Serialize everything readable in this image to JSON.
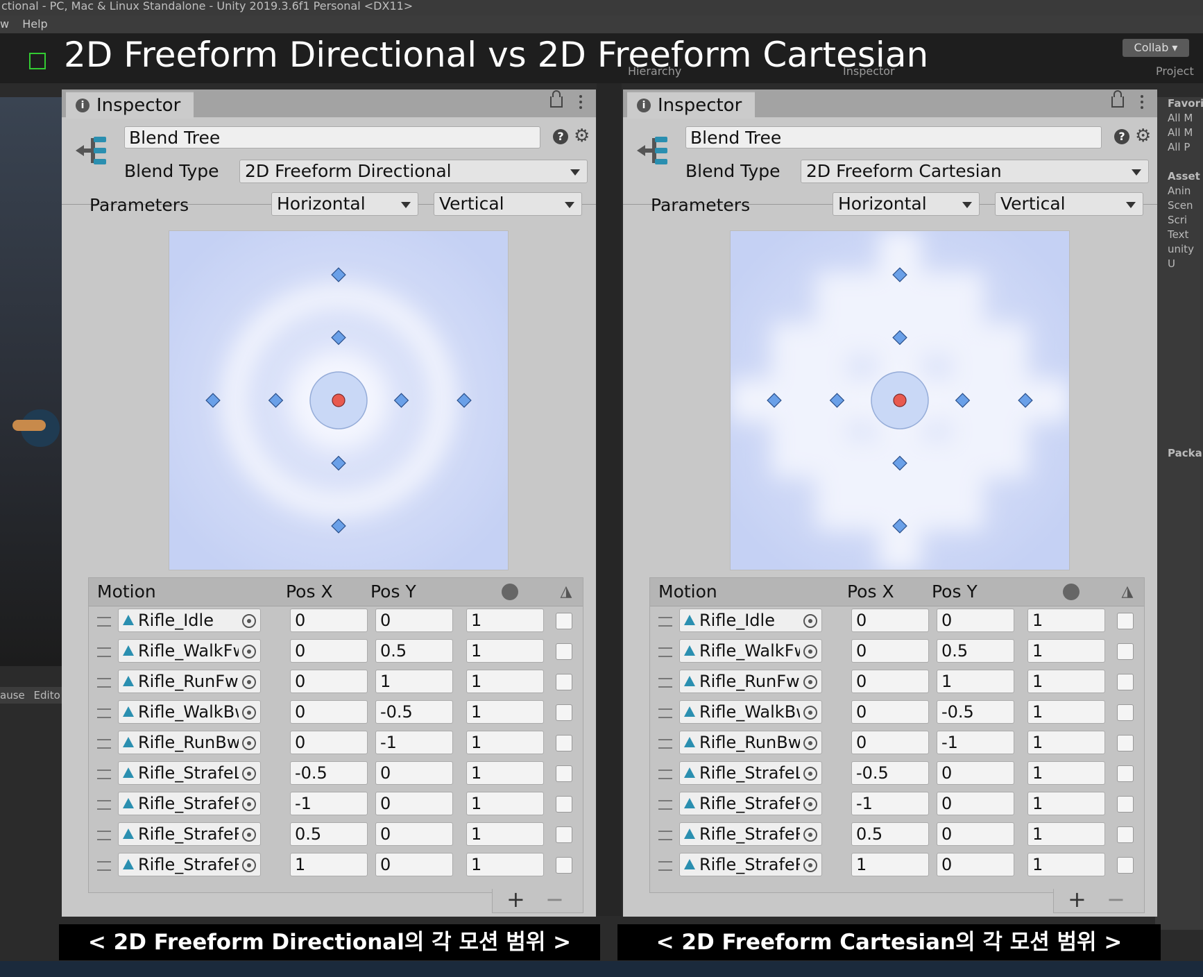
{
  "window": {
    "title_fragment": "ctional - PC, Mac & Linux Standalone - Unity 2019.3.6f1 Personal <DX11>",
    "menu": [
      "w",
      "Help"
    ],
    "collab": "Collab ▾",
    "hierarchy_tab": "Hierarchy",
    "inspector_tab": "Inspector",
    "project_tab": "Project",
    "gamebar": [
      "ause",
      "Edito"
    ],
    "project_items": [
      "Favori",
      "All M",
      "All M",
      "All P",
      "",
      "Asset",
      "Anin",
      "Scen",
      "Scri",
      "Text",
      "unity",
      "U",
      "",
      "",
      "",
      "",
      "",
      "",
      "",
      "",
      "",
      "",
      "",
      "",
      "Packa"
    ]
  },
  "video_title": "2D Freeform Directional vs 2D Freeform Cartesian",
  "panels": [
    {
      "tab_label": "Inspector",
      "name_value": "Blend Tree",
      "blend_type_label": "Blend Type",
      "blend_type_value": "2D Freeform Directional",
      "parameters_label": "Parameters",
      "param_x": "Horizontal",
      "param_y": "Vertical",
      "columns": {
        "motion": "Motion",
        "posx": "Pos X",
        "posy": "Pos Y"
      },
      "rows": [
        {
          "clip": "Rifle_Idle",
          "posx": "0",
          "posy": "0",
          "speed": "1"
        },
        {
          "clip": "Rifle_WalkFw",
          "posx": "0",
          "posy": "0.5",
          "speed": "1"
        },
        {
          "clip": "Rifle_RunFwd",
          "posx": "0",
          "posy": "1",
          "speed": "1"
        },
        {
          "clip": "Rifle_WalkBw",
          "posx": "0",
          "posy": "-0.5",
          "speed": "1"
        },
        {
          "clip": "Rifle_RunBwd",
          "posx": "0",
          "posy": "-1",
          "speed": "1"
        },
        {
          "clip": "Rifle_StrafeL",
          "posx": "-0.5",
          "posy": "0",
          "speed": "1"
        },
        {
          "clip": "Rifle_StrafeR",
          "posx": "-1",
          "posy": "0",
          "speed": "1"
        },
        {
          "clip": "Rifle_StrafeRi",
          "posx": "0.5",
          "posy": "0",
          "speed": "1"
        },
        {
          "clip": "Rifle_StrafeR",
          "posx": "1",
          "posy": "0",
          "speed": "1"
        }
      ],
      "add_label": "+",
      "remove_label": "−",
      "caption": "< 2D Freeform Directional의 각 모션 범위 >"
    },
    {
      "tab_label": "Inspector",
      "name_value": "Blend Tree",
      "blend_type_label": "Blend Type",
      "blend_type_value": "2D Freeform Cartesian",
      "parameters_label": "Parameters",
      "param_x": "Horizontal",
      "param_y": "Vertical",
      "columns": {
        "motion": "Motion",
        "posx": "Pos X",
        "posy": "Pos Y"
      },
      "rows": [
        {
          "clip": "Rifle_Idle",
          "posx": "0",
          "posy": "0",
          "speed": "1"
        },
        {
          "clip": "Rifle_WalkFw",
          "posx": "0",
          "posy": "0.5",
          "speed": "1"
        },
        {
          "clip": "Rifle_RunFwd",
          "posx": "0",
          "posy": "1",
          "speed": "1"
        },
        {
          "clip": "Rifle_WalkBw",
          "posx": "0",
          "posy": "-0.5",
          "speed": "1"
        },
        {
          "clip": "Rifle_RunBwd",
          "posx": "0",
          "posy": "-1",
          "speed": "1"
        },
        {
          "clip": "Rifle_StrafeL",
          "posx": "-0.5",
          "posy": "0",
          "speed": "1"
        },
        {
          "clip": "Rifle_StrafeR",
          "posx": "-1",
          "posy": "0",
          "speed": "1"
        },
        {
          "clip": "Rifle_StrafeRi",
          "posx": "0.5",
          "posy": "0",
          "speed": "1"
        },
        {
          "clip": "Rifle_StrafeR",
          "posx": "1",
          "posy": "0",
          "speed": "1"
        }
      ],
      "add_label": "+",
      "remove_label": "−",
      "caption": "< 2D Freeform Cartesian의 각 모션 범위 >"
    }
  ],
  "colors": {
    "node": "#6aa0e8",
    "selected_node": "#e85a4f",
    "graph_bg": "#e2e8fa",
    "graph_edge": "#bccaf2"
  }
}
